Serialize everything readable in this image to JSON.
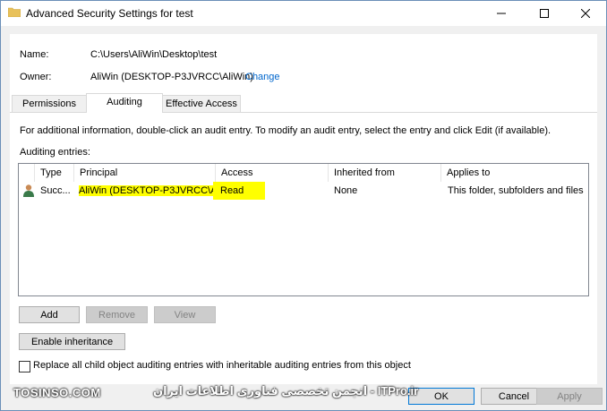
{
  "window": {
    "title": "Advanced Security Settings for test"
  },
  "info": {
    "name_label": "Name:",
    "name_value": "C:\\Users\\AliWin\\Desktop\\test",
    "owner_label": "Owner:",
    "owner_value": "AliWin (DESKTOP-P3JVRCC\\AliWin)",
    "change_link": "Change"
  },
  "tabs": [
    {
      "label": "Permissions"
    },
    {
      "label": "Auditing"
    },
    {
      "label": "Effective Access"
    }
  ],
  "auditing": {
    "description": "For additional information, double-click an audit entry. To modify an audit entry, select the entry and click Edit (if available).",
    "entries_label": "Auditing entries:",
    "columns": [
      "Type",
      "Principal",
      "Access",
      "Inherited from",
      "Applies to"
    ],
    "rows": [
      {
        "type": "Succ...",
        "principal": "AliWin (DESKTOP-P3JVRCC\\A...",
        "access": "Read",
        "inherited_from": "None",
        "applies_to": "This folder, subfolders and files"
      }
    ],
    "add_button": "Add",
    "remove_button": "Remove",
    "view_button": "View",
    "enable_inheritance_button": "Enable inheritance",
    "replace_checkbox_label": "Replace all child object auditing entries with inheritable auditing entries from this object"
  },
  "footer": {
    "ok_button": "OK",
    "cancel_button": "Cancel",
    "apply_button": "Apply"
  },
  "watermark": {
    "left": "TOSINSO.COM",
    "right": "انجمن تخصصی فناوری اطلاعات ایران - ITPro.ir"
  },
  "colors": {
    "highlight": "#ffff00",
    "link": "#0066cc",
    "accent": "#0078d7"
  }
}
